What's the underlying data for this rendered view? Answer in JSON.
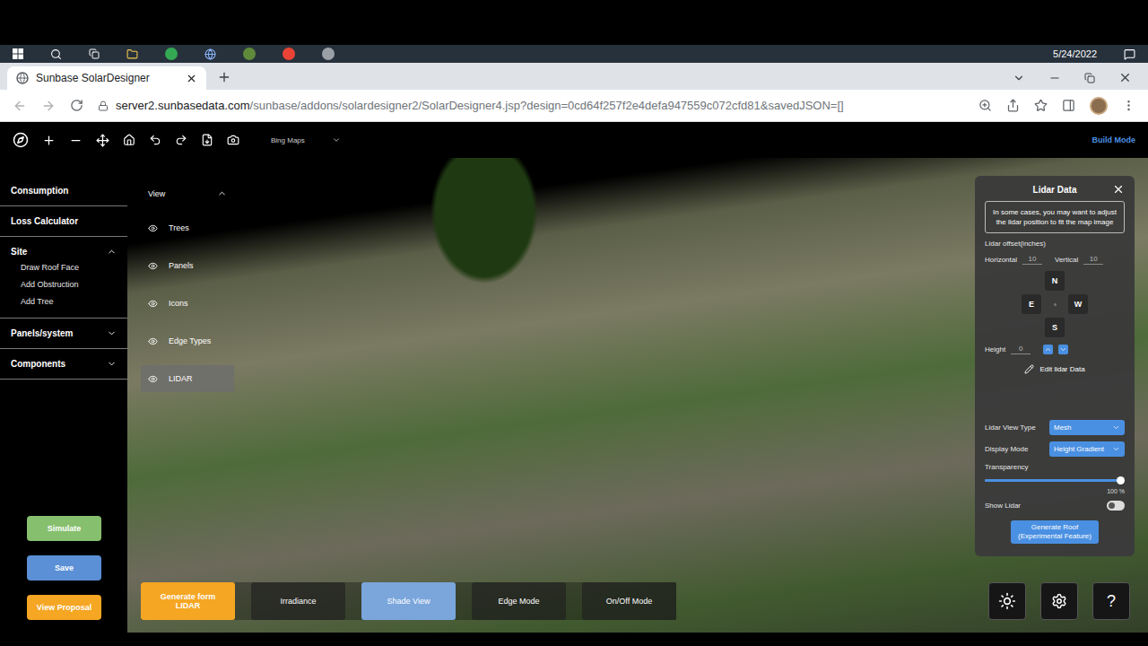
{
  "taskbar": {
    "date": "5/24/2022"
  },
  "browser": {
    "tab": {
      "title": "Sunbase SolarDesigner"
    },
    "url_host": "server2.sunbasedata.com",
    "url_path": "/sunbase/addons/solardesigner2/SolarDesigner4.jsp?design=0cd64f257f2e4defa947559c072cfd81&savedJSON=[]"
  },
  "toolbar": {
    "map_source": "Bing Maps",
    "mode": "Build Mode"
  },
  "sidebar": [
    {
      "label": "Consumption",
      "kind": "link"
    },
    {
      "label": "Loss Calculator",
      "kind": "link"
    },
    {
      "label": "Site",
      "kind": "group",
      "expanded": true,
      "items": [
        "Draw Roof Face",
        "Add Obstruction",
        "Add Tree"
      ]
    },
    {
      "label": "Panels/system",
      "kind": "group",
      "expanded": false
    },
    {
      "label": "Components",
      "kind": "group",
      "expanded": false
    }
  ],
  "actions": [
    {
      "label": "Simulate",
      "color": "#86bf6e"
    },
    {
      "label": "Save",
      "color": "#5b8fd6"
    },
    {
      "label": "View Proposal",
      "color": "#f5a623"
    }
  ],
  "view_menu": {
    "title": "View",
    "expanded": true,
    "items": [
      {
        "label": "Trees",
        "selected": false
      },
      {
        "label": "Panels",
        "selected": false
      },
      {
        "label": "Icons",
        "selected": false
      },
      {
        "label": "Edge Types",
        "selected": false
      },
      {
        "label": "LIDAR",
        "selected": true
      }
    ]
  },
  "modes": [
    {
      "label": "Generate form LIDAR",
      "kind": "action",
      "selected": false
    },
    {
      "label": "Irradiance",
      "kind": "mode",
      "selected": false
    },
    {
      "label": "Shade View",
      "kind": "mode",
      "selected": true
    },
    {
      "label": "Edge Mode",
      "kind": "mode",
      "selected": false
    },
    {
      "label": "On/Off Mode",
      "kind": "mode",
      "selected": false
    }
  ],
  "lidar_panel": {
    "title": "Lidar Data",
    "info": "In some cases, you may want to adjust the lidar position to fit the map image",
    "offset_label": "Lidar offset(inches)",
    "offsets": [
      {
        "label": "Horizontal",
        "value": "10"
      },
      {
        "label": "Vertical",
        "value": "10"
      }
    ],
    "directions": [
      "N",
      "E",
      "W",
      "S"
    ],
    "height": {
      "label": "Height",
      "value": "0"
    },
    "edit": "Edit lidar Data",
    "selects": [
      {
        "label": "Lidar View Type",
        "value": "Mesh"
      },
      {
        "label": "Display Mode",
        "value": "Height Gradient"
      }
    ],
    "transparency": {
      "label": "Transparency",
      "reading": "100 %",
      "level": 1
    },
    "show_lidar": {
      "label": "Show Lidar",
      "on": false
    },
    "generate": "Generate Roof (Experimental Feature)"
  },
  "corner_buttons": {
    "help": "?"
  }
}
